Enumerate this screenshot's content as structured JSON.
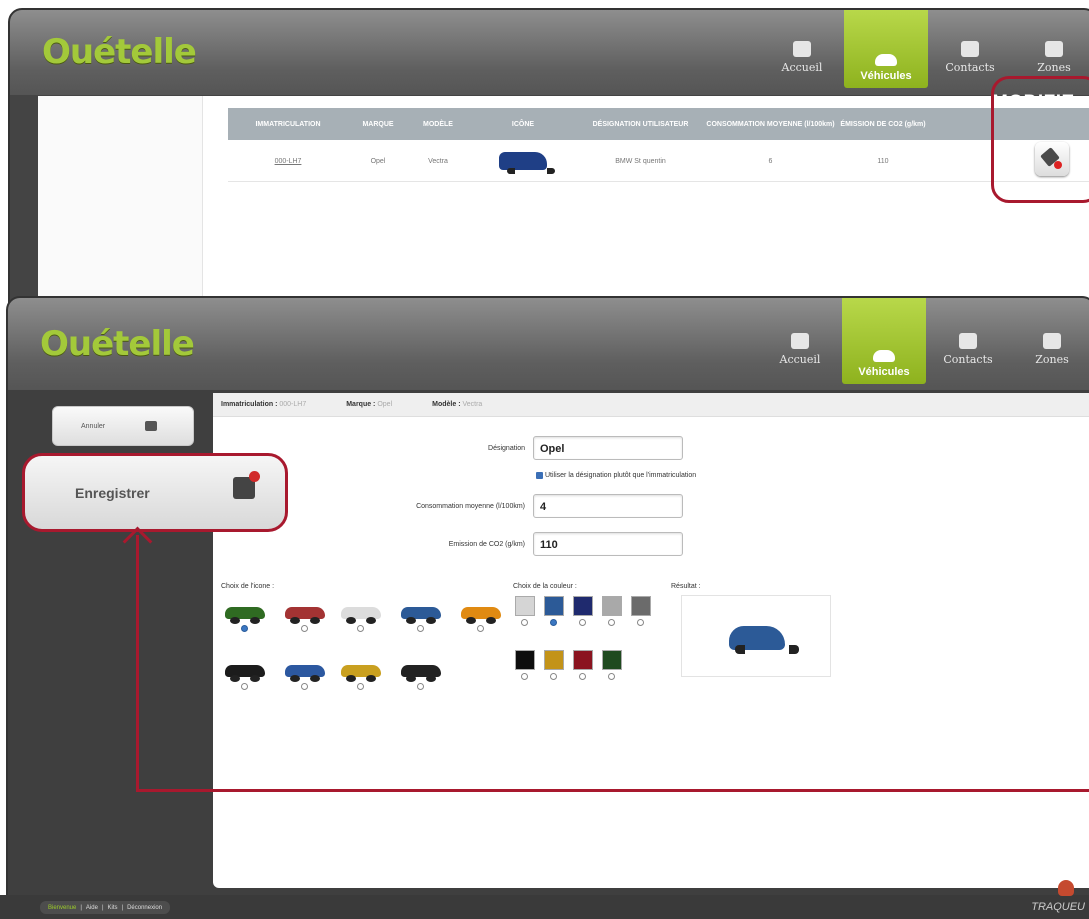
{
  "app": {
    "logo": "Ouételle"
  },
  "nav": [
    {
      "label": "Accueil"
    },
    {
      "label": "Véhicules"
    },
    {
      "label": "Contacts"
    },
    {
      "label": "Zones"
    }
  ],
  "list_window": {
    "headers": [
      "IMMATRICULATION",
      "MARQUE",
      "MODÈLE",
      "ICÔNE",
      "DÉSIGNATION UTILISATEUR",
      "CONSOMMATION MOYENNE (l/100km)",
      "ÉMISSION DE CO2 (g/km)"
    ],
    "row": [
      "000-LH7",
      "Opel",
      "Vectra",
      "",
      "BMW St quentin",
      "6",
      "110"
    ],
    "modify_label": "MODIFIE"
  },
  "edit_window": {
    "info": {
      "immat_label": "Immatriculation :",
      "immat_value": "000-LH7",
      "marque_label": "Marque :",
      "marque_value": "Opel",
      "modele_label": "Modèle :",
      "modele_value": "Vectra"
    },
    "designation_label": "Désignation",
    "designation_value": "Opel",
    "checkbox_label": "Utiliser la désignation plutôt que l'immatriculation",
    "conso_label": "Consommation moyenne (l/100km)",
    "conso_value": "4",
    "co2_label": "Emission de CO2 (g/km)",
    "co2_value": "110",
    "icon_choice_label": "Choix de l'icone :",
    "color_choice_label": "Choix de la couleur :",
    "result_label": "Résultat :",
    "icons": [
      {
        "name": "green-car-icon",
        "color": "#2f6b22",
        "selected": true
      },
      {
        "name": "motorbike-icon",
        "color": "#a33333",
        "selected": false
      },
      {
        "name": "white-car-icon",
        "color": "#dcdcdc",
        "selected": false
      },
      {
        "name": "blue-hatchback-icon",
        "color": "#2c5a97",
        "selected": false
      },
      {
        "name": "orange-car-icon",
        "color": "#e08a12",
        "selected": false
      },
      {
        "name": "black-suv-icon",
        "color": "#1c1c1c",
        "selected": false
      },
      {
        "name": "blue-van-icon",
        "color": "#2c58a0",
        "selected": false
      },
      {
        "name": "construction-vehicle-icon",
        "color": "#c9a020",
        "selected": false
      },
      {
        "name": "boat-icon",
        "color": "#222222",
        "selected": false
      }
    ],
    "colors": [
      {
        "hex": "#d5d5d5",
        "selected": false
      },
      {
        "hex": "#2c5a97",
        "selected": true
      },
      {
        "hex": "#1f2a6e",
        "selected": false
      },
      {
        "hex": "#a9a9a9",
        "selected": false
      },
      {
        "hex": "#6b6b6b",
        "selected": false
      },
      {
        "hex": "#0d0d0d",
        "selected": false
      },
      {
        "hex": "#c39318",
        "selected": false
      },
      {
        "hex": "#8b1420",
        "selected": false
      },
      {
        "hex": "#1f4a1f",
        "selected": false
      }
    ]
  },
  "actions": {
    "cancel_label": "Annuler",
    "save_label": "Enregistrer"
  },
  "footer": {
    "links": [
      "Bienvenue",
      "Aide",
      "Kits",
      "Déconnexion"
    ],
    "brand": "TRAQUEU"
  },
  "accent_colors": {
    "brand_green": "#a3c93a",
    "callout_red": "#a8192e"
  }
}
